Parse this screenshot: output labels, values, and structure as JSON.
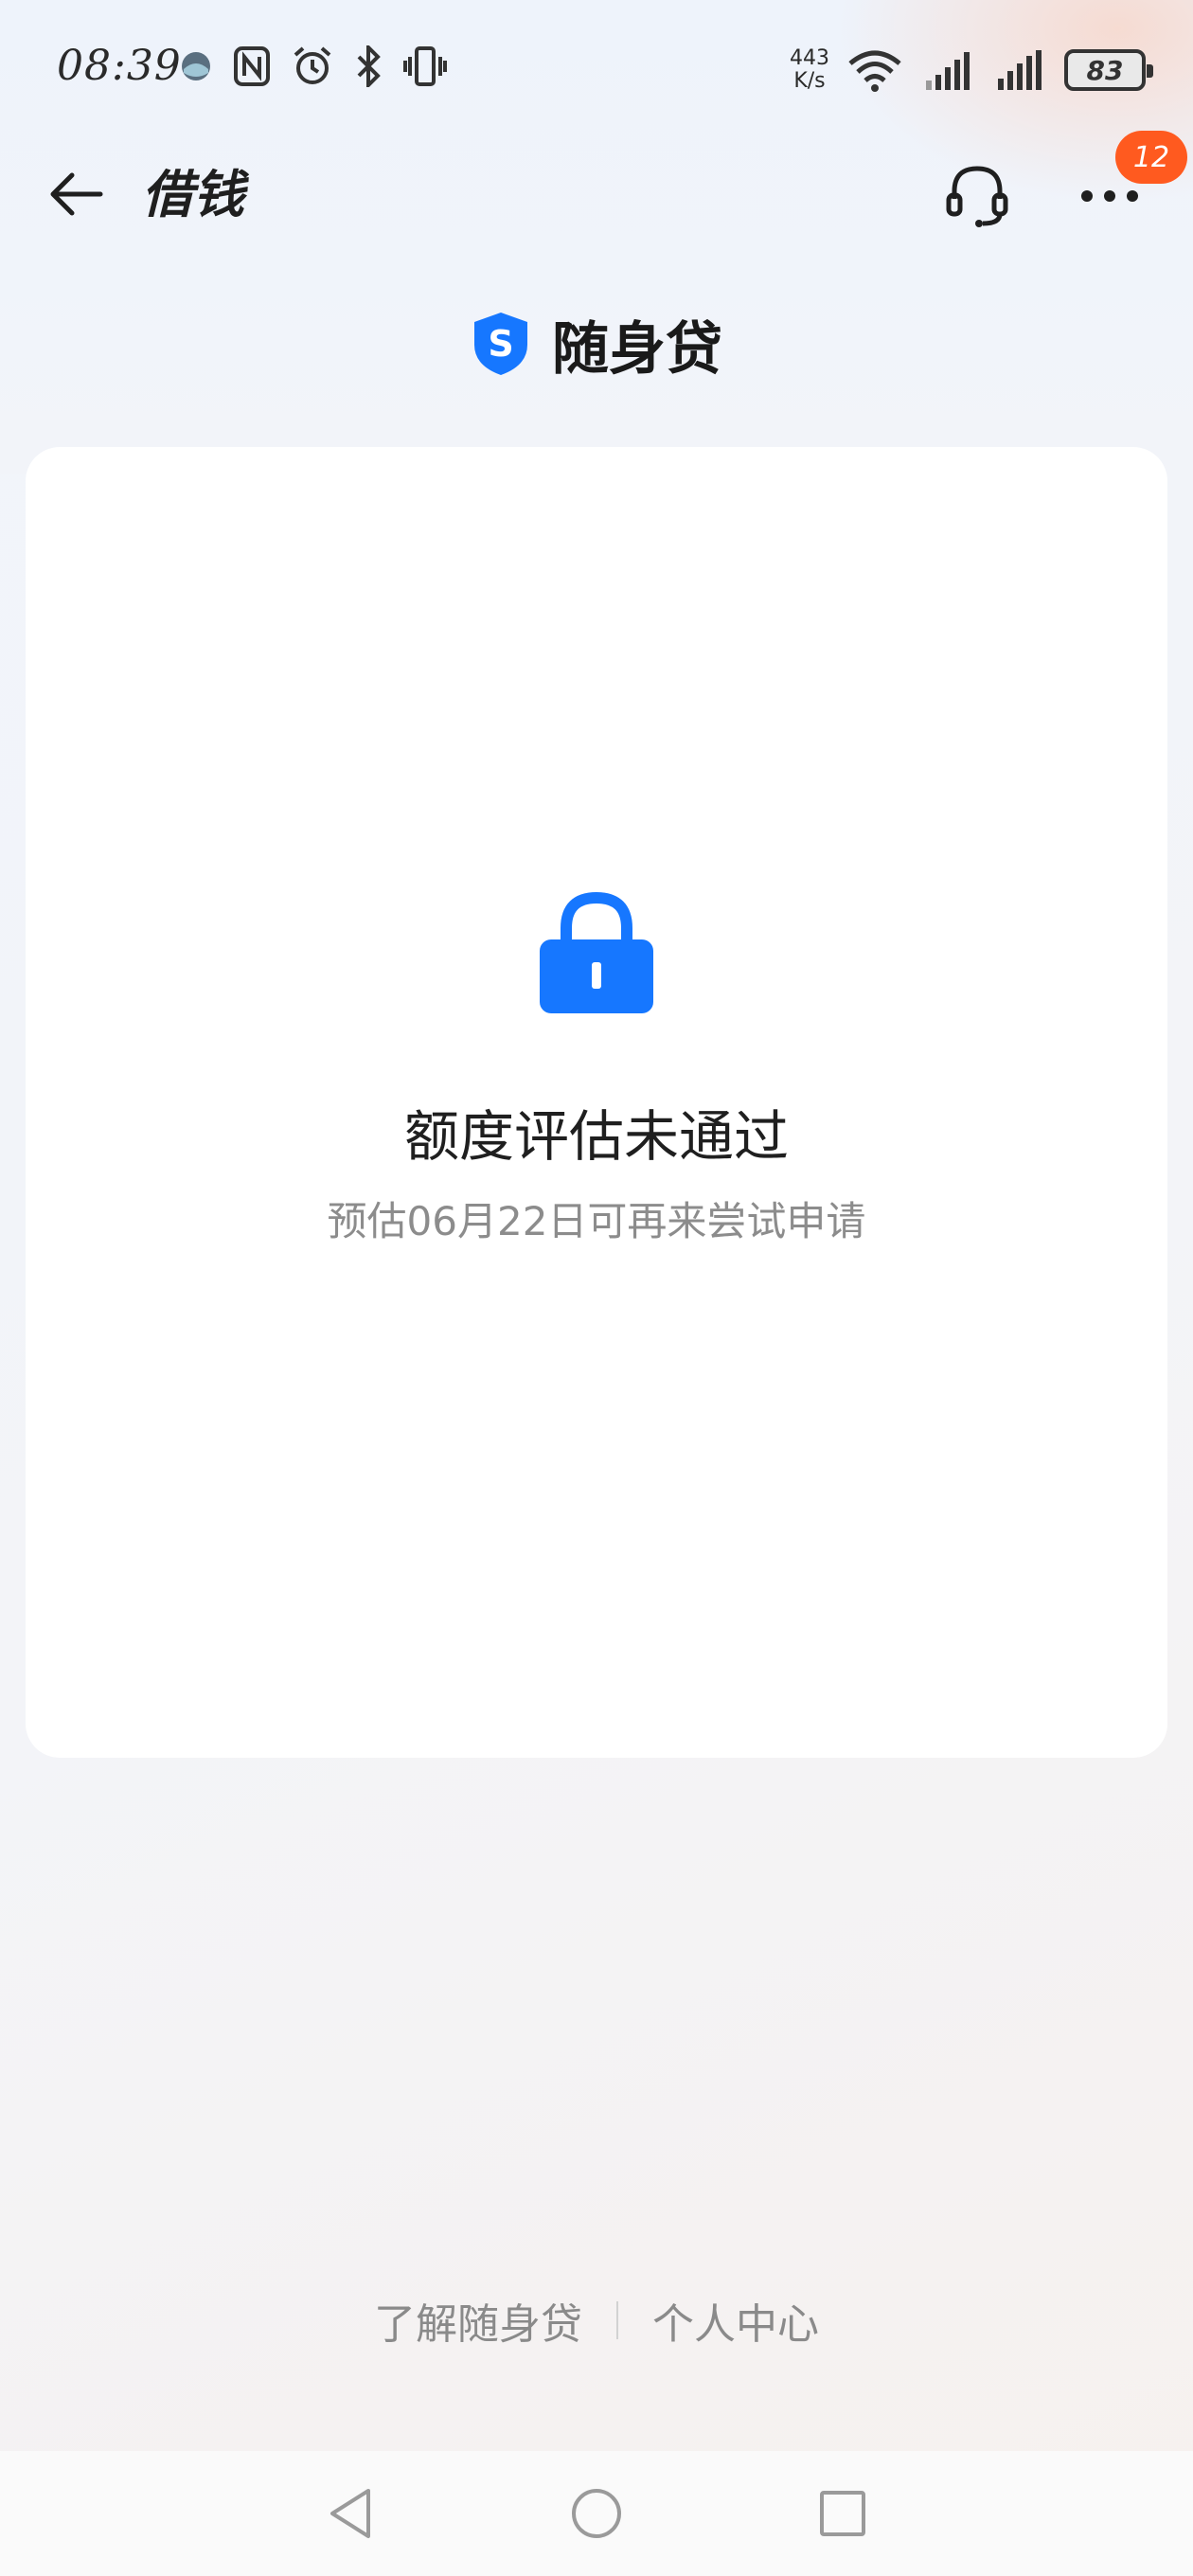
{
  "status_bar": {
    "time": "08:39",
    "net_speed_value": "443",
    "net_speed_unit": "K/s",
    "battery": "83"
  },
  "header": {
    "title": "借钱",
    "badge_count": "12"
  },
  "brand": {
    "name": "随身贷",
    "logo_letter": "S"
  },
  "result": {
    "title": "额度评估未通过",
    "subtitle": "预估06月22日可再来尝试申请"
  },
  "footer": {
    "link_about": "了解随身贷",
    "link_profile": "个人中心"
  },
  "colors": {
    "accent_blue": "#1677ff",
    "badge_orange": "#ff5a1f"
  }
}
